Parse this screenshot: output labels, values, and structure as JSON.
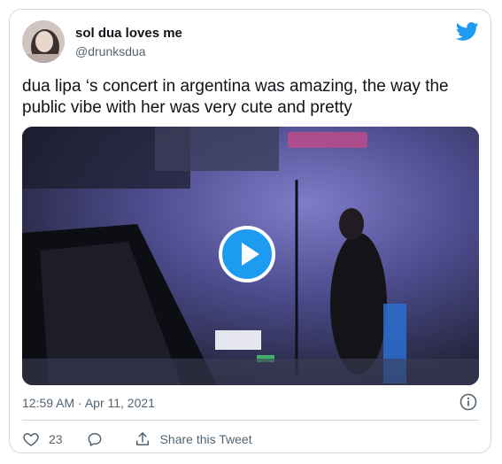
{
  "tweet": {
    "display_name": "sol dua loves me",
    "handle": "@drunksdua",
    "text": "dua lipa ‘s concert in argentina was amazing, the way the public vibe with her was very cute and pretty",
    "timestamp": "12:59 AM · Apr 11, 2021",
    "likes": "23",
    "share_label": "Share this Tweet"
  },
  "icons": {
    "brand": "twitter-bird-icon",
    "play": "play-icon",
    "info": "info-icon",
    "like": "heart-icon",
    "reply": "reply-bubble-icon",
    "share": "share-icon"
  },
  "colors": {
    "accent": "#1d9bf0",
    "text_primary": "#0f1419",
    "text_secondary": "#536471",
    "border": "#cfd9de"
  }
}
